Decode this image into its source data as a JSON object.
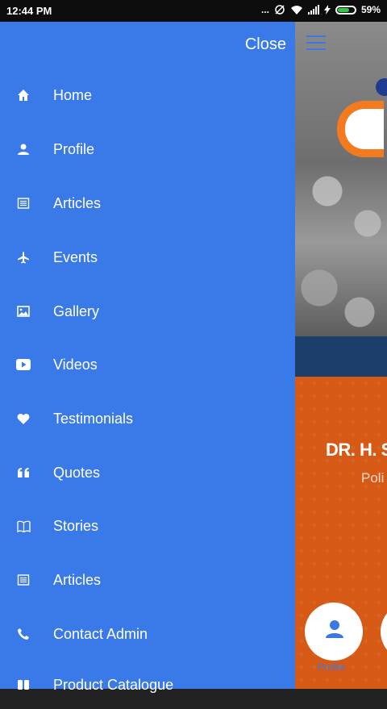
{
  "status_bar": {
    "time": "12:44 PM",
    "indicators": "...",
    "battery": "59%"
  },
  "drawer": {
    "close_label": "Close",
    "items": [
      {
        "label": "Home",
        "icon": "home-icon"
      },
      {
        "label": "Profile",
        "icon": "person-icon"
      },
      {
        "label": "Articles",
        "icon": "newspaper-icon"
      },
      {
        "label": "Events",
        "icon": "airplane-icon"
      },
      {
        "label": "Gallery",
        "icon": "image-icon"
      },
      {
        "label": "Videos",
        "icon": "play-icon"
      },
      {
        "label": "Testimonials",
        "icon": "heart-icon"
      },
      {
        "label": "Quotes",
        "icon": "quote-icon"
      },
      {
        "label": "Stories",
        "icon": "book-icon"
      },
      {
        "label": "Articles",
        "icon": "newspaper-icon"
      },
      {
        "label": "Contact Admin",
        "icon": "phone-icon"
      },
      {
        "label": "Product Catalogue",
        "icon": "catalogue-icon"
      }
    ]
  },
  "background_app": {
    "name_text": "DR. H. S",
    "subtitle_text": "Poli",
    "fab_label": "Profile"
  },
  "colors": {
    "drawer_bg": "#3a7ae8",
    "accent_orange": "#d65a16",
    "band_blue": "#1b3e6a"
  }
}
